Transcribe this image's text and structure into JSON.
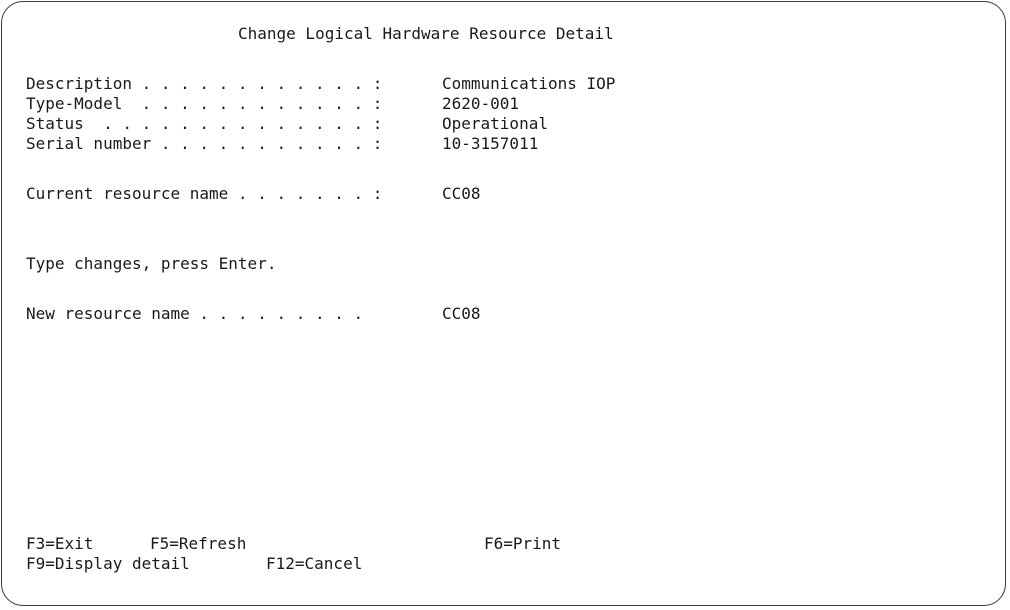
{
  "screen": {
    "title": "Change Logical Hardware Resource Detail"
  },
  "details": {
    "description": {
      "label": "Description . . . . . . . . . . . . :",
      "value": "Communications IOP"
    },
    "type_model": {
      "label": "Type-Model  . . . . . . . . . . . . :",
      "value": "2620-001"
    },
    "status": {
      "label": "Status  . . . . . . . . . . . . . . :",
      "value": "Operational"
    },
    "serial_number": {
      "label": "Serial number . . . . . . . . . . . :",
      "value": "10-3157011"
    },
    "current_resource_name": {
      "label": "Current resource name . . . . . . . :",
      "value": "CC08"
    }
  },
  "instructions": "Type changes, press Enter.",
  "new_resource_name": {
    "label": "New resource name . . . . . . . . .",
    "value": "CC08"
  },
  "function_keys": {
    "f3": "F3=Exit",
    "f5": "F5=Refresh",
    "f6": "F6=Print",
    "f9": "F9=Display detail",
    "f12": "F12=Cancel"
  }
}
